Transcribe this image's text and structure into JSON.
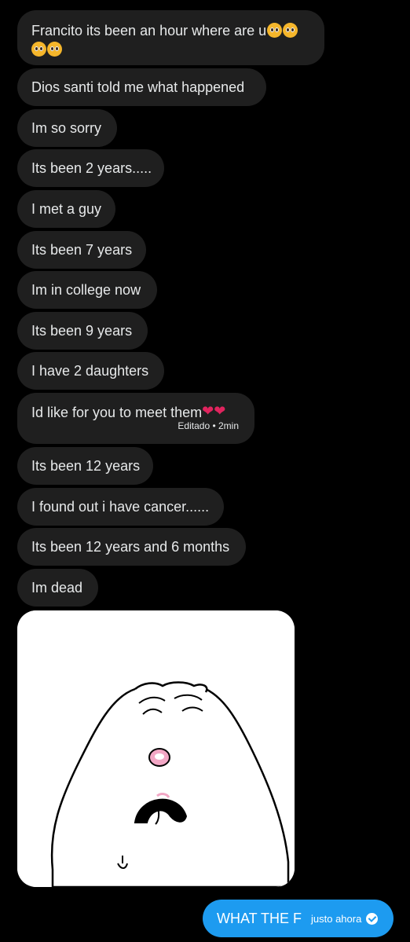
{
  "messages": [
    {
      "line1": "Francito its been an hour where are u"
    },
    {
      "text": "Dios santi told me what happened"
    },
    {
      "text": "Im so sorry"
    },
    {
      "text": "Its been 2 years....."
    },
    {
      "text": "I met a guy"
    },
    {
      "text": "Its been 7 years"
    },
    {
      "text": "Im in college now"
    },
    {
      "text": "Its been 9 years"
    },
    {
      "text": "I have 2 daughters"
    },
    {
      "text": "Id like for you to meet them",
      "meta": "Editado • 2min"
    },
    {
      "text": "Its been 12 years"
    },
    {
      "text": "I found out i have cancer......"
    },
    {
      "text": "Its been 12 years and 6 months"
    },
    {
      "text": "Im dead"
    }
  ],
  "sent": {
    "text": "WHAT THE F",
    "time": "justo ahora"
  },
  "icons": {
    "pleading_emoji": "pleading-face",
    "broken_heart": "broken-heart",
    "read_receipt": "check-circle"
  },
  "colors": {
    "background": "#000000",
    "incoming_bubble": "#1f1f1f",
    "outgoing_bubble": "#1d9bf0",
    "text": "#e7e9ea"
  }
}
